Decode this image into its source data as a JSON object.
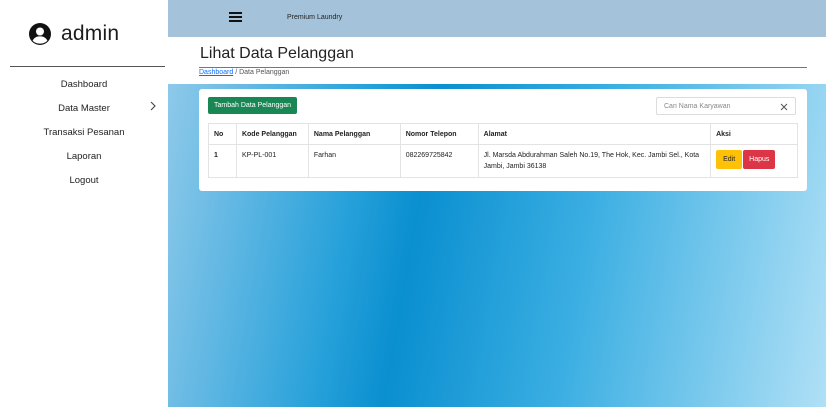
{
  "sidebar": {
    "username": "admin",
    "items": [
      {
        "label": "Dashboard"
      },
      {
        "label": "Data Master"
      },
      {
        "label": "Transaksi Pesanan"
      },
      {
        "label": "Laporan"
      },
      {
        "label": "Logout"
      }
    ]
  },
  "topbar": {
    "app_title": "Premium Laundry"
  },
  "page": {
    "title": "Lihat Data Pelanggan",
    "breadcrumb": {
      "link": "Dashboard",
      "separator": "/",
      "current": "Data Pelanggan"
    }
  },
  "toolbar": {
    "add_label": "Tambah Data Pelanggan",
    "search_placeholder": "Cari Nama Karyawan"
  },
  "table": {
    "headers": [
      "No",
      "Kode Pelanggan",
      "Nama Pelanggan",
      "Nomor Telepon",
      "Alamat",
      "Aksi"
    ],
    "rows": [
      {
        "no": "1",
        "kode": "KP-PL-001",
        "nama": "Farhan",
        "telepon": "082269725842",
        "alamat": "Jl. Marsda Abdurahman Saleh No.19, The Hok, Kec. Jambi Sel., Kota Jambi, Jambi 36138",
        "edit_label": "Edit",
        "hapus_label": "Hapus"
      }
    ]
  },
  "colors": {
    "topbar": "#a4c3da",
    "add_button": "#198754",
    "edit_button": "#ffc107",
    "delete_button": "#dc3545",
    "link": "#0d6efd"
  },
  "icons": [
    "user-circle-icon",
    "hamburger-menu-icon",
    "chevron-right-icon",
    "close-icon"
  ]
}
